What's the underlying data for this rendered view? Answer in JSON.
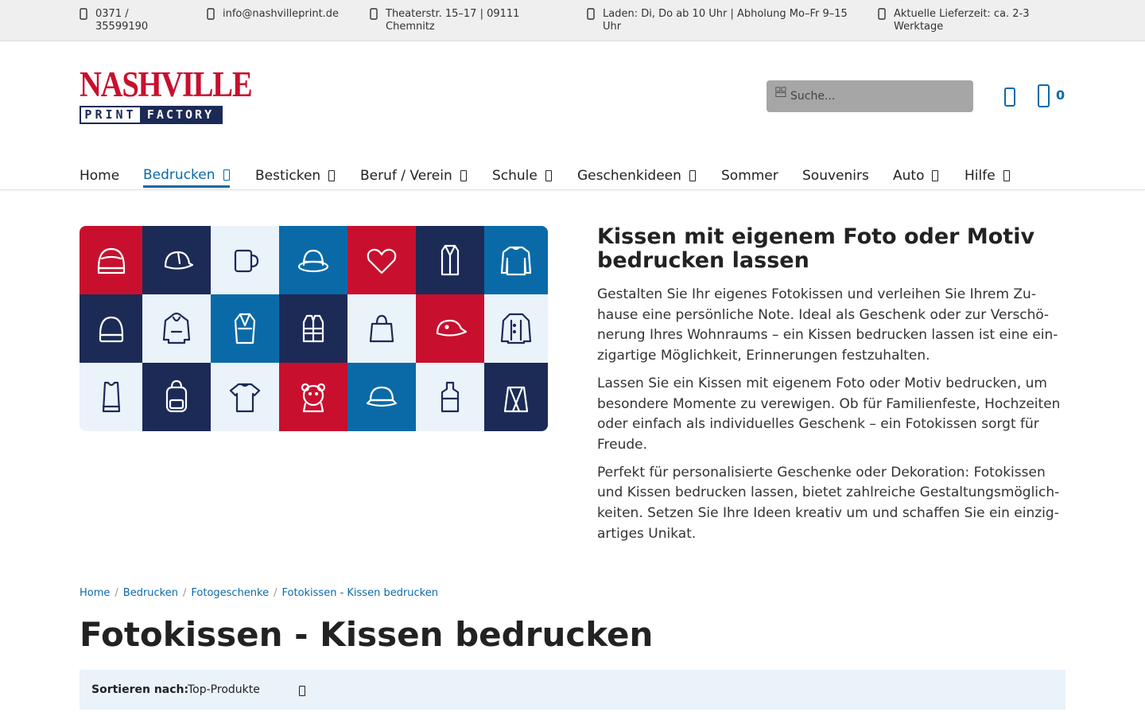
{
  "topbar": {
    "phone": "0371 / 35599190",
    "email": "info@nashvilleprint.de",
    "address": "Theaterstr. 15–17 | 09111 Chemnitz",
    "hours": "Laden: Di, Do ab 10 Uhr | Abholung Mo–Fr 9–15 Uhr",
    "delivery": "Aktuelle Lieferzeit: ca. 2-3 Werktage"
  },
  "logo": {
    "line1": "NASHVILLE",
    "line2a": "PRINT",
    "line2b": "FACTORY"
  },
  "search": {
    "placeholder": "Suche..."
  },
  "cart": {
    "count": "0"
  },
  "nav": {
    "home": "Home",
    "bedrucken": "Bedrucken",
    "besticken": "Besticken",
    "beruf": "Beruf / Verein",
    "schule": "Schule",
    "geschenkideen": "Geschenkideen",
    "sommer": "Sommer",
    "souvenirs": "Souvenirs",
    "auto": "Auto",
    "hilfe": "Hilfe"
  },
  "hero": {
    "title": "Kissen mit eigenem Foto oder Motiv bedrucken lassen",
    "p1": "Gestalten Sie Ihr eigenes Fotokissen und verleihen Sie Ihrem Zu­hause eine persönliche Note. Ideal als Geschenk oder zur Verschö­nerung Ihres Wohnraums – ein Kissen bedrucken lassen ist eine ein­zigartige Möglichkeit, Erinnerungen festzuhalten.",
    "p2": "Lassen Sie ein Kissen mit eigenem Foto oder Motiv bedrucken, um besondere Momente zu verewigen. Ob für Familienfeste, Hochzeiten oder einfach als individuelles Geschenk – ein Fotokissen sorgt für Freude.",
    "p3": "Perfekt für personalisierte Geschenke oder Dekoration: Fotokissen und Kissen bedrucken lassen, bietet zahlreiche Gestaltungsmöglich­keiten. Setzen Sie Ihre Ideen kreativ um und schaffen Sie ein einzig­artiges Unikat."
  },
  "tiles": [
    {
      "bg": "#c8102e",
      "fg": "#ffffff",
      "icon": "beanie-icon"
    },
    {
      "bg": "#1c2a56",
      "fg": "#ffffff",
      "icon": "cap-icon"
    },
    {
      "bg": "#eaf2fa",
      "fg": "#1c2a56",
      "icon": "mug-icon"
    },
    {
      "bg": "#0a6aa8",
      "fg": "#ffffff",
      "icon": "hat-icon"
    },
    {
      "bg": "#c8102e",
      "fg": "#ffffff",
      "icon": "heart-icon"
    },
    {
      "bg": "#1c2a56",
      "fg": "#ffffff",
      "icon": "bathrobe-icon"
    },
    {
      "bg": "#0a6aa8",
      "fg": "#ffffff",
      "icon": "sweater-icon"
    },
    {
      "bg": "#1c2a56",
      "fg": "#ffffff",
      "icon": "knit-hat-icon"
    },
    {
      "bg": "#eaf2fa",
      "fg": "#1c2a56",
      "icon": "hoodie-icon"
    },
    {
      "bg": "#0a6aa8",
      "fg": "#ffffff",
      "icon": "robe-icon"
    },
    {
      "bg": "#1c2a56",
      "fg": "#ffffff",
      "icon": "safety-vest-icon"
    },
    {
      "bg": "#eaf2fa",
      "fg": "#1c2a56",
      "icon": "tote-bag-icon"
    },
    {
      "bg": "#c8102e",
      "fg": "#ffffff",
      "icon": "baseball-cap-icon"
    },
    {
      "bg": "#eaf2fa",
      "fg": "#1c2a56",
      "icon": "chef-jacket-icon"
    },
    {
      "bg": "#eaf2fa",
      "fg": "#1c2a56",
      "icon": "tank-top-icon"
    },
    {
      "bg": "#1c2a56",
      "fg": "#ffffff",
      "icon": "backpack-icon"
    },
    {
      "bg": "#eaf2fa",
      "fg": "#1c2a56",
      "icon": "tshirt-icon"
    },
    {
      "bg": "#c8102e",
      "fg": "#ffffff",
      "icon": "teddy-icon"
    },
    {
      "bg": "#0a6aa8",
      "fg": "#ffffff",
      "icon": "visor-cap-icon"
    },
    {
      "bg": "#eaf2fa",
      "fg": "#1c2a56",
      "icon": "apron-icon"
    },
    {
      "bg": "#1c2a56",
      "fg": "#ffffff",
      "icon": "gym-bag-icon"
    }
  ],
  "breadcrumb": [
    "Home",
    "Bedrucken",
    "Fotogeschenke",
    "Fotokissen - Kissen bedrucken"
  ],
  "page_title": "Fotokissen - Kissen bedrucken",
  "sort": {
    "label": "Sortieren nach:",
    "value": "Top-Produkte"
  },
  "colors": {
    "accent": "#0a6aa8",
    "brand_red": "#c8102e",
    "navy": "#1c2a56"
  }
}
